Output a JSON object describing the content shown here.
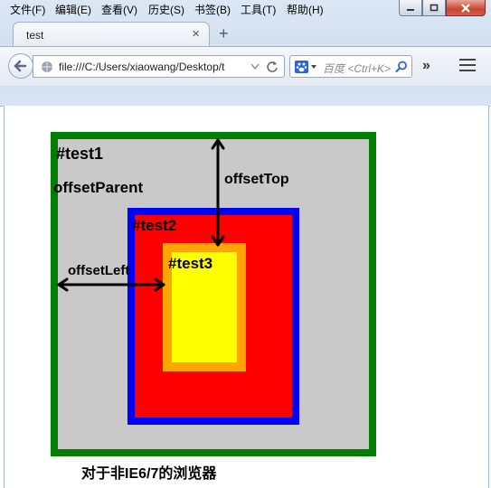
{
  "menubar": {
    "items": [
      {
        "label": "文件(F)"
      },
      {
        "label": "编辑(E)"
      },
      {
        "label": "查看(V)"
      },
      {
        "label": "历史(S)"
      },
      {
        "label": "书签(B)"
      },
      {
        "label": "工具(T)"
      },
      {
        "label": "帮助(H)"
      }
    ]
  },
  "tab": {
    "title": "test",
    "close_glyph": "×",
    "new_tab_glyph": "+"
  },
  "navbar": {
    "url": "file:///C:/Users/xiaowang/Desktop/t",
    "search_placeholder": "百度 <Ctrl+K>",
    "overflow_glyph": "»"
  },
  "page": {
    "test1_label": "#test1",
    "offset_parent_label": "offsetParent",
    "offset_top_label": "offsetTop",
    "test2_label": "#test2",
    "test3_label": "#test3",
    "offset_left_label": "offsetLeft",
    "caption": "对于非IE6/7的浏览器"
  },
  "colors": {
    "test1_bg": "#c9c9c9",
    "test1_border": "#007f00",
    "test2_bg": "#ff0000",
    "test2_border": "#0000ff",
    "test3_bg": "#ffff00",
    "test3_border": "#ffa500"
  }
}
